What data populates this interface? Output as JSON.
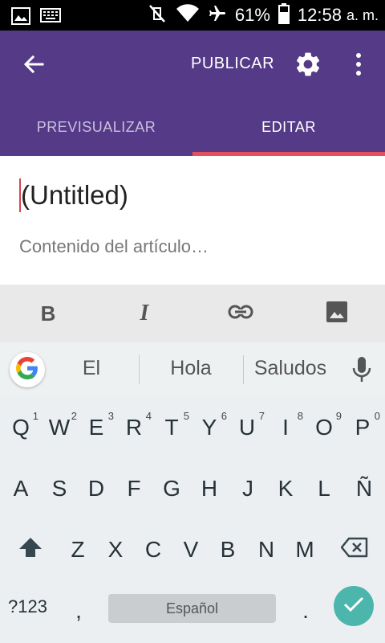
{
  "status_bar": {
    "battery": "61%",
    "time": "12:58",
    "ampm": "a. m.",
    "icons": [
      "image-icon",
      "keyboard-icon",
      "mute-vibrate-icon",
      "wifi-icon",
      "airplane-mode-icon",
      "battery-icon"
    ]
  },
  "app_bar": {
    "back_icon": "arrow-left-icon",
    "publish_label": "PUBLICAR",
    "settings_icon": "gear-icon",
    "more_icon": "more-vert-icon",
    "bg_color": "#553b87",
    "tabs": [
      {
        "label": "PREVISUALIZAR",
        "active": false
      },
      {
        "label": "EDITAR",
        "active": true
      }
    ],
    "indicator_color": "#e5505d"
  },
  "editor": {
    "title": "(Untitled)",
    "content_placeholder": "Contenido del artículo…"
  },
  "format_toolbar": {
    "bold_label": "B",
    "italic_label": "I",
    "link_icon": "link-icon",
    "image_icon": "insert-image-icon"
  },
  "suggestions": {
    "items": [
      "El",
      "Hola",
      "Saludos"
    ],
    "google_icon": "google-g-icon",
    "mic_icon": "microphone-icon"
  },
  "keyboard": {
    "row1": [
      {
        "k": "Q",
        "h": "1"
      },
      {
        "k": "W",
        "h": "2"
      },
      {
        "k": "E",
        "h": "3"
      },
      {
        "k": "R",
        "h": "4"
      },
      {
        "k": "T",
        "h": "5"
      },
      {
        "k": "Y",
        "h": "6"
      },
      {
        "k": "U",
        "h": "7"
      },
      {
        "k": "I",
        "h": "8"
      },
      {
        "k": "O",
        "h": "9"
      },
      {
        "k": "P",
        "h": "0"
      }
    ],
    "row2": [
      "A",
      "S",
      "D",
      "F",
      "G",
      "H",
      "J",
      "K",
      "L",
      "Ñ"
    ],
    "row3": [
      "Z",
      "X",
      "C",
      "V",
      "B",
      "N",
      "M"
    ],
    "symbols_label": "?123",
    "comma_label": ",",
    "space_label": "Español",
    "period_label": ".",
    "enter_color": "#4db6ac"
  }
}
